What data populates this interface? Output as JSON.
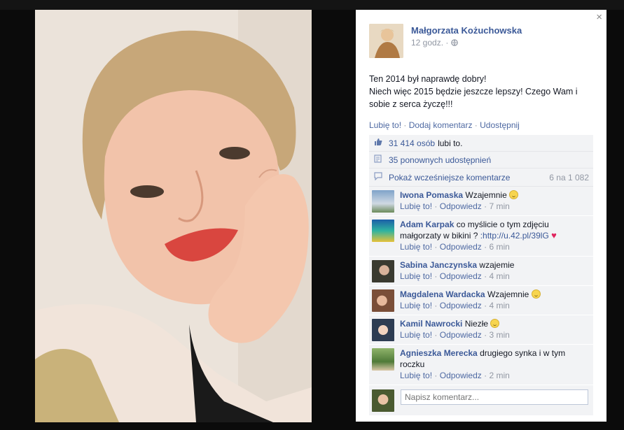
{
  "post": {
    "author": "Małgorzata Kożuchowska",
    "time": "12 godz.",
    "privacy_icon": "globe-icon",
    "text_lines": [
      "Ten 2014 był naprawdę dobry!",
      "Niech więc 2015 będzie jeszcze lepszy! Czego Wam i",
      "sobie z serca życzę!!!"
    ]
  },
  "actions": {
    "like": "Lubię to!",
    "comment": "Dodaj komentarz",
    "share": "Udostępnij",
    "separator": "·"
  },
  "ufi": {
    "likes_count": "31 414 osób",
    "likes_suffix": "lubi to.",
    "shares": "35 ponownych udostępnień",
    "previous_comments": "Pokaż wcześniejsze komentarze",
    "comments_count": "6 na 1 082"
  },
  "comments": [
    {
      "name": "Iwona Pomaska",
      "text": "Wzajemnie",
      "emoji": "smile",
      "time": "7 min"
    },
    {
      "name": "Adam Karpak",
      "text": "co myślicie o tym zdjęciu małgorzaty w bikini ?",
      "link": ":http://u.42.pl/39lG",
      "emoji": "heart",
      "time": "6 min"
    },
    {
      "name": "Sabina Janczynska",
      "text": "wzajemie",
      "time": "4 min"
    },
    {
      "name": "Magdalena Wardacka",
      "text": "Wzajemnie",
      "emoji": "smile",
      "time": "4 min"
    },
    {
      "name": "Kamil Nawrocki",
      "text": "Niezłe",
      "emoji": "grin",
      "time": "3 min"
    },
    {
      "name": "Agnieszka Merecka",
      "text": "drugiego synka i w tym roczku",
      "time": "2 min"
    }
  ],
  "comment_actions": {
    "like": "Lubię to!",
    "reply": "Odpowiedz",
    "separator": "·"
  },
  "compose": {
    "placeholder": "Napisz komentarz..."
  },
  "close_glyph": "×",
  "colors": {
    "link": "#3b5998",
    "panel_bg": "#ffffff",
    "ufi_bg": "#f2f3f5",
    "backdrop": "#0b0b0b"
  }
}
